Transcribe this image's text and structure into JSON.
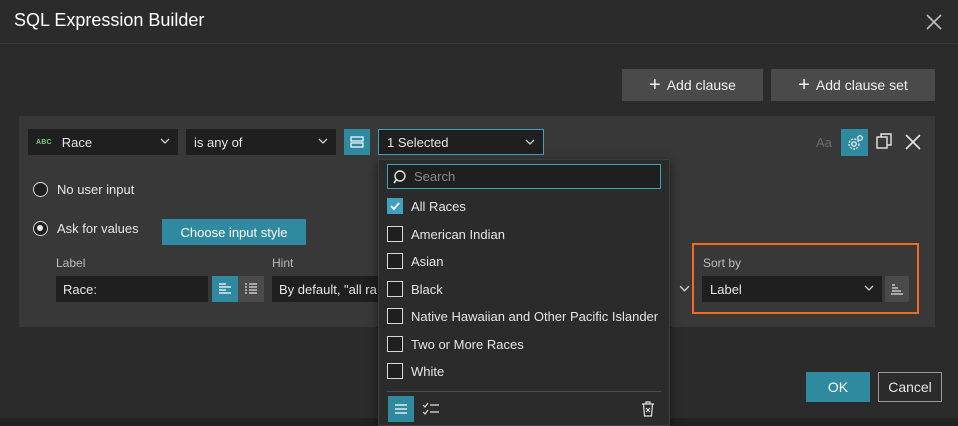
{
  "dialog": {
    "title": "SQL Expression Builder"
  },
  "toolbar": {
    "add_clause": "Add clause",
    "add_clause_set": "Add clause set"
  },
  "clause": {
    "field_type_badge": "ABC",
    "field": "Race",
    "operator": "is any of",
    "value_summary": "1 Selected",
    "case_icon_text": "Aa"
  },
  "input_options": {
    "no_user_input": "No user input",
    "ask_for_values": "Ask for values",
    "selected": "ask_for_values",
    "choose_input_style": "Choose input style"
  },
  "fields": {
    "label_title": "Label",
    "label_value": "Race:",
    "hint_title": "Hint",
    "hint_value": "By default, \"all ra",
    "sort_by_title": "Sort by",
    "sort_by_value": "Label"
  },
  "dropdown": {
    "search_placeholder": "Search",
    "options": [
      {
        "label": "All Races",
        "checked": true
      },
      {
        "label": "American Indian",
        "checked": false
      },
      {
        "label": "Asian",
        "checked": false
      },
      {
        "label": "Black",
        "checked": false
      },
      {
        "label": "Native Hawaiian and Other Pacific Islander",
        "checked": false
      },
      {
        "label": "Two or More Races",
        "checked": false
      },
      {
        "label": "White",
        "checked": false
      }
    ]
  },
  "footer": {
    "ok": "OK",
    "cancel": "Cancel"
  },
  "colors": {
    "accent": "#2f8aa0",
    "highlight_outline": "#f26b1d",
    "background": "#2b2b2b",
    "panel": "#383838"
  }
}
